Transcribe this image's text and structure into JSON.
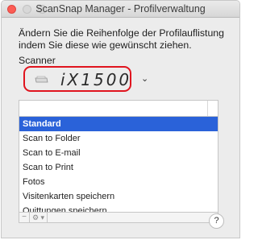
{
  "window": {
    "title": "ScanSnap Manager - Profilverwaltung"
  },
  "instructions": "Ändern Sie die Reihenfolge der Profilauflistung indem Sie diese wie gewünscht ziehen.",
  "scanner": {
    "label": "Scanner",
    "model": "iX1500",
    "icon": "scanner-icon",
    "dropdown_icon": "chevron-down-icon",
    "highlight_color": "#e0141e"
  },
  "profiles": {
    "items": [
      {
        "label": "Standard",
        "selected": true
      },
      {
        "label": "Scan to Folder",
        "selected": false
      },
      {
        "label": "Scan to E-mail",
        "selected": false
      },
      {
        "label": "Scan to Print",
        "selected": false
      },
      {
        "label": "Fotos",
        "selected": false
      },
      {
        "label": "Visitenkarten speichern",
        "selected": false
      },
      {
        "label": "Quittungen speichern",
        "selected": false
      }
    ],
    "selection_color": "#2a62d9"
  },
  "toolbar": {
    "remove_symbol": "−",
    "action_symbol": "⚙ ▾"
  },
  "help": {
    "symbol": "?"
  }
}
